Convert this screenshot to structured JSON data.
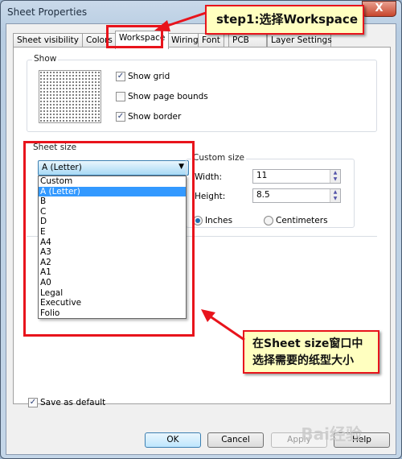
{
  "window": {
    "title": "Sheet Properties",
    "close_label": "X"
  },
  "tabs": [
    {
      "label": "Sheet visibility"
    },
    {
      "label": "Colors"
    },
    {
      "label": "Workspace"
    },
    {
      "label": "Wiring"
    },
    {
      "label": "Font"
    },
    {
      "label": "PCB"
    },
    {
      "label": "Layer Settings"
    }
  ],
  "show": {
    "label": "Show",
    "show_grid": "Show grid",
    "show_page_bounds": "Show page bounds",
    "show_border": "Show border",
    "checked": {
      "show_grid": true,
      "show_page_bounds": false,
      "show_border": true
    }
  },
  "sheet_size": {
    "label": "Sheet size",
    "selected": "A (Letter)",
    "options": [
      "Custom",
      "A (Letter)",
      "B",
      "C",
      "D",
      "E",
      "A4",
      "A3",
      "A2",
      "A1",
      "A0",
      "Legal",
      "Executive",
      "Folio"
    ]
  },
  "custom_size": {
    "label": "Custom size",
    "width_label": "Width:",
    "width_value": "11",
    "height_label": "Height:",
    "height_value": "8.5",
    "inches": "Inches",
    "centimeters": "Centimeters",
    "unit_selected": "Inches"
  },
  "save_default": {
    "label": "Save as default",
    "checked": true
  },
  "buttons": {
    "ok": "OK",
    "cancel": "Cancel",
    "apply": "Apply",
    "help": "Help"
  },
  "annotations": {
    "step1": "step1:选择Workspace",
    "step2_line1": "在Sheet size窗口中",
    "step2_line2": "选择需要的纸型大小",
    "accent": "#e8141c",
    "callout_bg": "#ffffc0"
  },
  "watermark": "Bai经验"
}
